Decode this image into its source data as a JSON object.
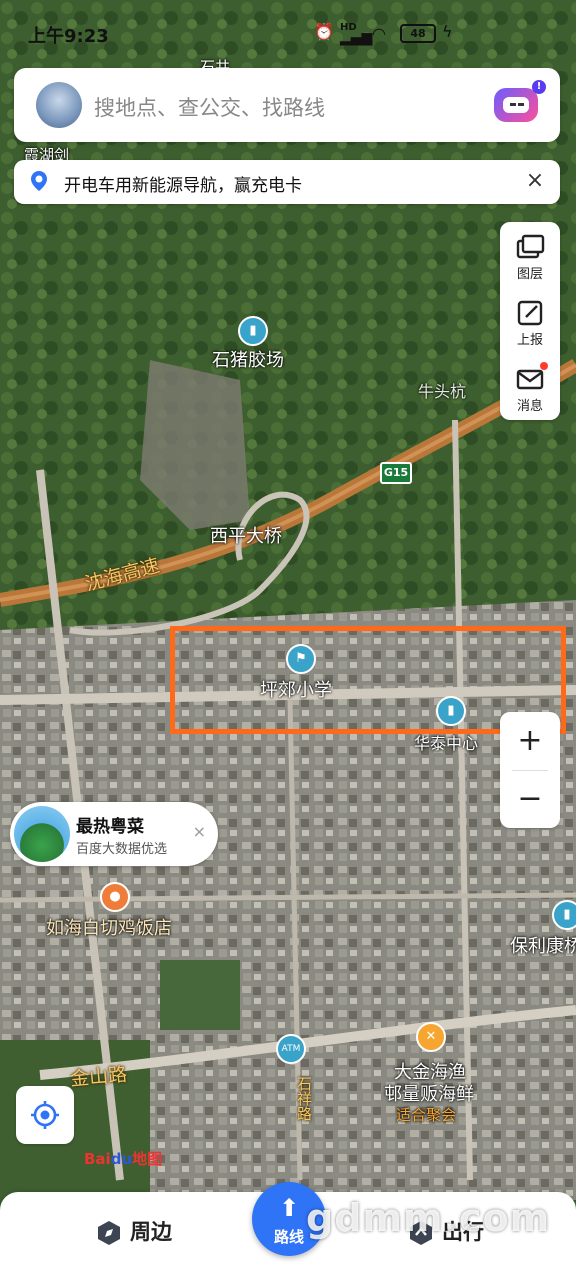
{
  "status_bar": {
    "time": "上午9:23",
    "battery": "48",
    "network": "HD"
  },
  "search": {
    "placeholder": "搜地点、查公交、找路线",
    "assistant_badge": "!"
  },
  "banner": {
    "text": "开电车用新能源导航，赢充电卡",
    "close": "×"
  },
  "tools": [
    {
      "label": "图层",
      "icon": "layers-icon"
    },
    {
      "label": "上报",
      "icon": "report-edit-icon"
    },
    {
      "label": "消息",
      "icon": "message-mail-icon",
      "has_dot": true
    }
  ],
  "zoom": {
    "in": "+",
    "out": "−"
  },
  "map_labels": {
    "shizhu": "石猪胶场",
    "niutouhang": "牛头杭",
    "xiping_bridge": "西平大桥",
    "highway": "沈海高速",
    "highway_shield": "G15",
    "school": "坪郊小学",
    "center": "华泰中心",
    "poly": "保利康桥",
    "jinshan_road": "金山路",
    "restaurant": "如海白切鸡饭店",
    "seafood_1": "大金海渔",
    "seafood_2": "邨量贩海鲜",
    "seafood_3": "适合聚会",
    "atm": "ATM",
    "road_vertical": "石祥路",
    "top_clip_1": "石井",
    "top_clip_2": "霞湖剑"
  },
  "food_card": {
    "title": "最热粤菜",
    "subtitle": "百度大数据优选",
    "close": "×"
  },
  "logo": {
    "brand": "Bai",
    "brand_paw": "du",
    "suffix": "地图"
  },
  "bottom_nav": {
    "nearby": "周边",
    "route": "路线",
    "travel": "出行"
  },
  "watermark": "gdmm.com",
  "colors": {
    "route_button": "#2f73f6",
    "highlight": "#ff6a1a",
    "highway": "#b9773a",
    "message_dot": "#ff3b30"
  }
}
